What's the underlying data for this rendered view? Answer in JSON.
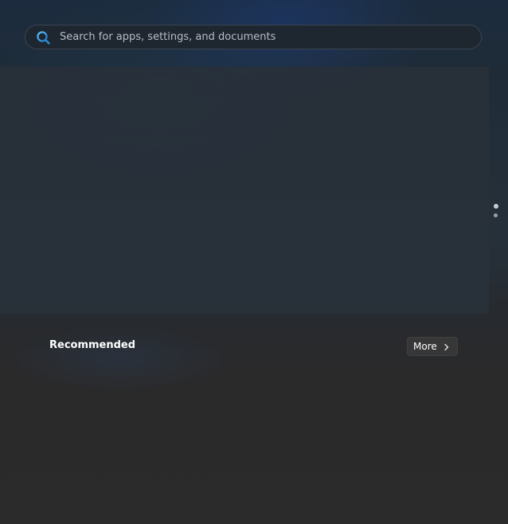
{
  "search": {
    "placeholder": "Search for apps, settings, and documents",
    "icon": "search-icon"
  },
  "pinned": {
    "pages": 2,
    "current_page": 1
  },
  "recommended": {
    "title": "Recommended",
    "more_label": "More",
    "more_icon": "chevron-right-icon"
  },
  "colors": {
    "search_icon_accent": "#3aa0e6",
    "text_primary": "#ffffff",
    "placeholder": "#b9bdc3",
    "button_bg": "#373738"
  }
}
